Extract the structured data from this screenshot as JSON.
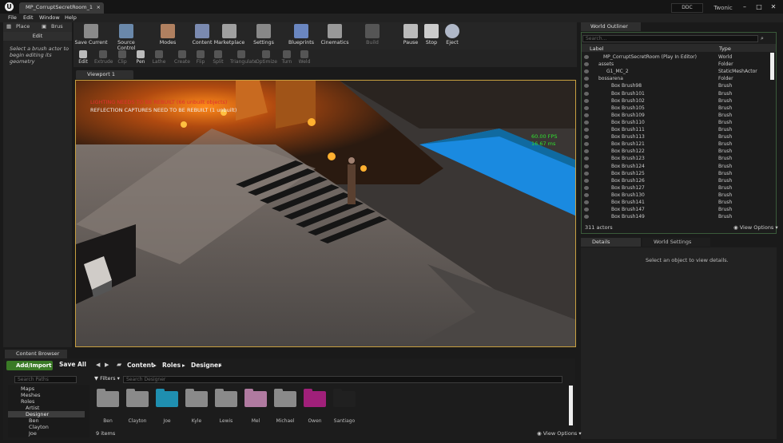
{
  "window": {
    "tab_title": "MP_CorruptSecretRoom_1",
    "ddc": "DDC",
    "user": "Twonic"
  },
  "menu": [
    "File",
    "Edit",
    "Window",
    "Help"
  ],
  "modes": {
    "place": "Place",
    "brush": "Brus",
    "edit": "Edit",
    "hint": "Select a brush actor to begin editing its geometry"
  },
  "toolbar": [
    "Save Current",
    "Source Control",
    "Modes",
    "Content",
    "Marketplace",
    "Settings",
    "Blueprints",
    "Cinematics",
    "Build",
    "Pause",
    "Stop",
    "Eject"
  ],
  "subtools": [
    "Edit",
    "Extrude",
    "Clip",
    "Pen",
    "Lathe",
    "Create",
    "Flip",
    "Split",
    "Triangulate",
    "Optimize",
    "Turn",
    "Weld"
  ],
  "viewport": {
    "tab": "Viewport 1",
    "msg1": "LIGHTING NEEDS TO BE REBUILT (66 unbuilt objects)",
    "msg2": "REFLECTION CAPTURES NEED TO BE REBUILT (1 unbuilt)",
    "fps": "60.00 FPS",
    "ms": "16.67 ms"
  },
  "outliner": {
    "tab": "World Outliner",
    "search_placeholder": "Search...",
    "col_label": "Label",
    "col_type": "Type",
    "rows": [
      {
        "label": "MP_CorruptSecretRoom (Play In Editor)",
        "type": "World"
      },
      {
        "label": "assets",
        "type": "Folder"
      },
      {
        "label": "G1_MC_2",
        "type": "StaticMeshActor"
      },
      {
        "label": "bossarena",
        "type": "Folder"
      },
      {
        "label": "Box Brush98",
        "type": "Brush"
      },
      {
        "label": "Box Brush101",
        "type": "Brush"
      },
      {
        "label": "Box Brush102",
        "type": "Brush"
      },
      {
        "label": "Box Brush105",
        "type": "Brush"
      },
      {
        "label": "Box Brush109",
        "type": "Brush"
      },
      {
        "label": "Box Brush110",
        "type": "Brush"
      },
      {
        "label": "Box Brush111",
        "type": "Brush"
      },
      {
        "label": "Box Brush113",
        "type": "Brush"
      },
      {
        "label": "Box Brush121",
        "type": "Brush"
      },
      {
        "label": "Box Brush122",
        "type": "Brush"
      },
      {
        "label": "Box Brush123",
        "type": "Brush"
      },
      {
        "label": "Box Brush124",
        "type": "Brush"
      },
      {
        "label": "Box Brush125",
        "type": "Brush"
      },
      {
        "label": "Box Brush126",
        "type": "Brush"
      },
      {
        "label": "Box Brush127",
        "type": "Brush"
      },
      {
        "label": "Box Brush130",
        "type": "Brush"
      },
      {
        "label": "Box Brush141",
        "type": "Brush"
      },
      {
        "label": "Box Brush147",
        "type": "Brush"
      },
      {
        "label": "Box Brush149",
        "type": "Brush"
      }
    ],
    "actors": "311 actors",
    "view_options": "View Options"
  },
  "details": {
    "tab": "Details",
    "tab2": "World Settings",
    "empty": "Select an object to view details."
  },
  "content_browser": {
    "tab": "Content Browser",
    "add": "Add/Import",
    "save_all": "Save All",
    "path": [
      "Content",
      "Roles",
      "Designer"
    ],
    "search_paths": "Search Paths",
    "filters": "Filters",
    "search": "Search Designer",
    "tree": [
      "Maps",
      "Meshes",
      "Roles",
      "Artist",
      "Designer",
      "Ben",
      "Clayton",
      "Joe"
    ],
    "folders": [
      {
        "name": "Ben",
        "color": "#8a8a8a"
      },
      {
        "name": "Clayton",
        "color": "#8a8a8a"
      },
      {
        "name": "Joe",
        "color": "#1f8fb0"
      },
      {
        "name": "Kyle",
        "color": "#8a8a8a"
      },
      {
        "name": "Lewis",
        "color": "#8a8a8a"
      },
      {
        "name": "Mel",
        "color": "#b07aa0"
      },
      {
        "name": "Michael",
        "color": "#8a8a8a"
      },
      {
        "name": "Owen",
        "color": "#a0207a"
      },
      {
        "name": "Santiago",
        "color": "#202020"
      }
    ],
    "items": "9 items",
    "view_options": "View Options"
  }
}
